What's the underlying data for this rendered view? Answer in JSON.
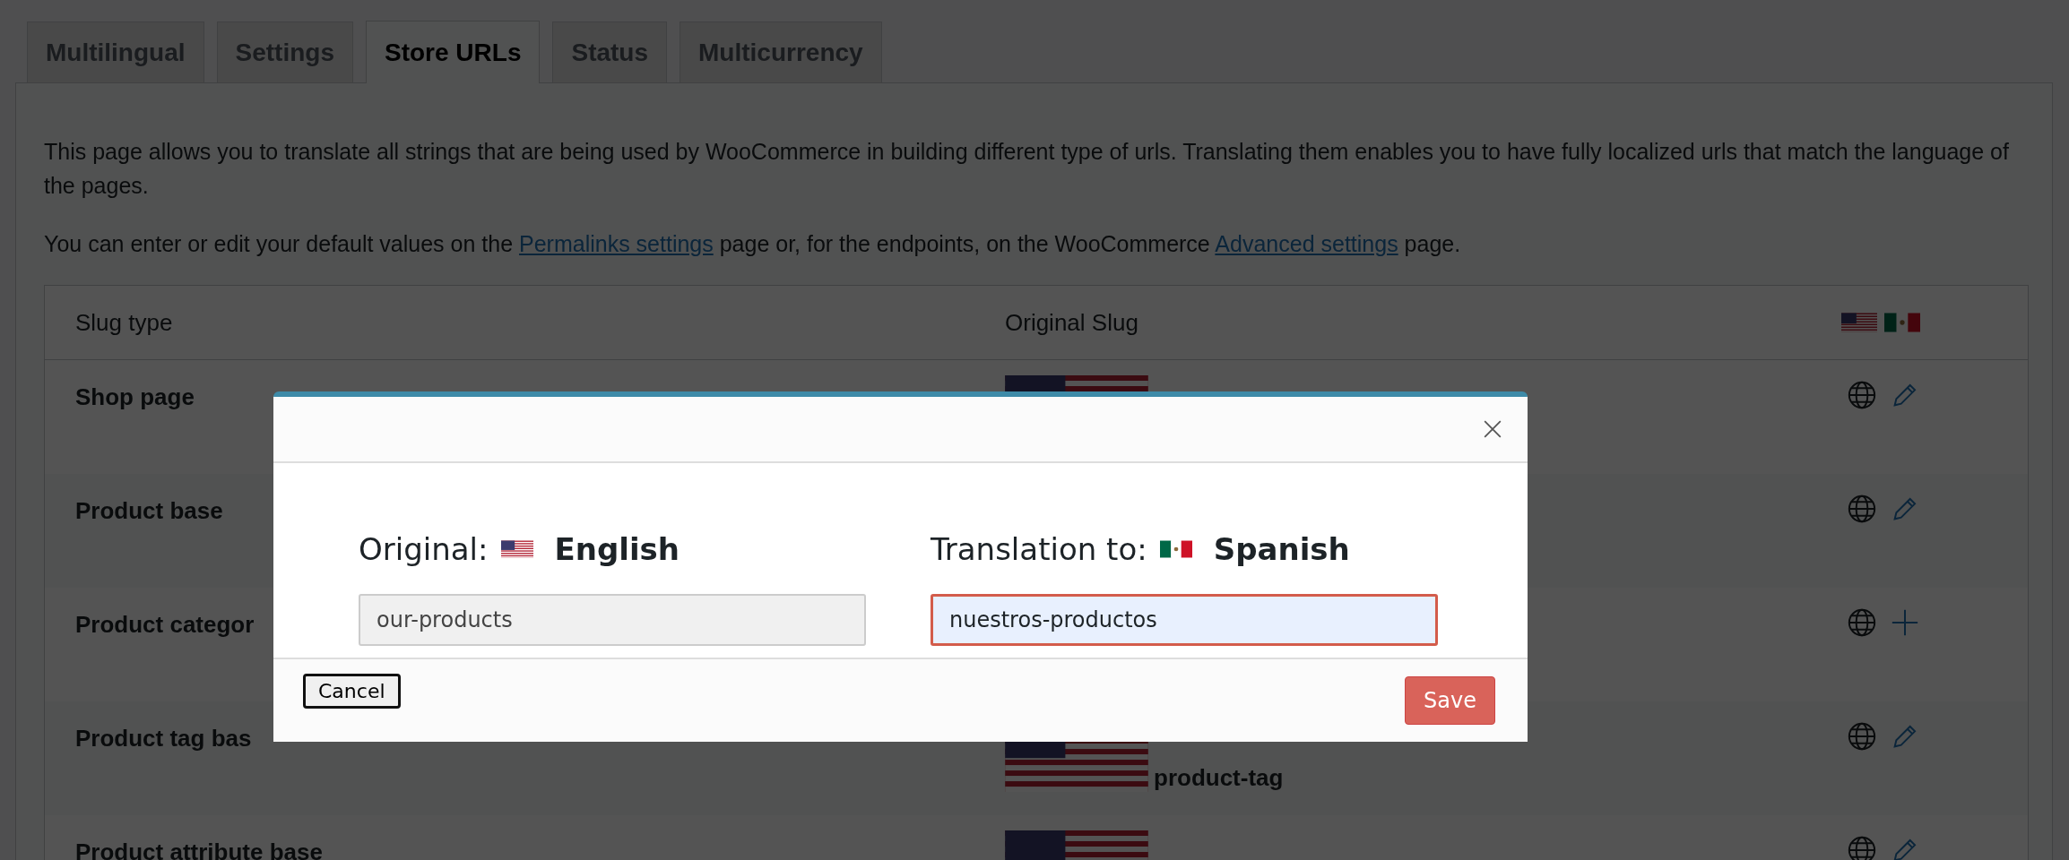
{
  "tabs": [
    {
      "label": "Multilingual",
      "selected": false
    },
    {
      "label": "Settings",
      "selected": false
    },
    {
      "label": "Store URLs",
      "selected": true
    },
    {
      "label": "Status",
      "selected": false
    },
    {
      "label": "Multicurrency",
      "selected": false
    }
  ],
  "intro": "This page allows you to translate all strings that are being used by WooCommerce in building different type of urls. Translating them enables you to have fully localized urls that match the language of the pages.",
  "links_paragraph": {
    "before": "You can enter or edit your default values on the ",
    "link_1": "Permalinks settings",
    "middle": " page or, for the endpoints, on the WooCommerce ",
    "link_2": "Advanced settings",
    "after": " page."
  },
  "table": {
    "columns": [
      "Slug type",
      "Original Slug"
    ],
    "rows": [
      {
        "slug_type": "Shop page",
        "kind": "edit"
      },
      {
        "slug_type": "Product base",
        "kind": "edit"
      },
      {
        "slug_type": "Product categor",
        "kind": "add"
      },
      {
        "slug_type": "Product tag bas",
        "original_slug": "product-tag",
        "kind": "edit"
      },
      {
        "slug_type": "Product attribute base",
        "kind": "edit"
      }
    ]
  },
  "modal": {
    "original_label": "Original:",
    "original_language": "English",
    "original_value": "our-products",
    "translation_label": "Translation to:",
    "translation_language": "Spanish",
    "translation_value": "nuestros-productos",
    "cancel": "Cancel",
    "save": "Save"
  }
}
